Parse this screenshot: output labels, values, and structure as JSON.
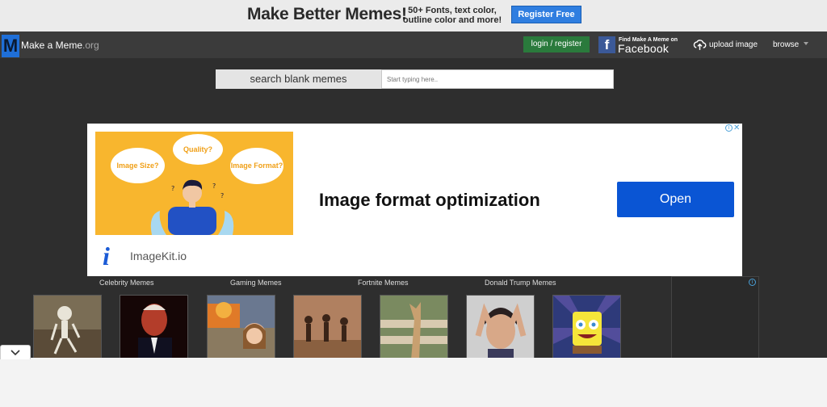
{
  "promo": {
    "title": "Make Better Memes!",
    "subtitle_line1": "50+ Fonts, text color,",
    "subtitle_line2": "outline color and more!",
    "register_label": "Register Free"
  },
  "nav": {
    "logo_letter": "M",
    "logo_name": "Make a Meme",
    "logo_tld": ".org",
    "login_label": "login / register",
    "facebook_small": "Find Make A Meme on",
    "facebook_big": "Facebook",
    "upload_label": "upload image",
    "browse_label": "browse"
  },
  "search": {
    "label": "search blank memes",
    "placeholder": "Start typing here.."
  },
  "ad": {
    "bubbles": [
      "Image Size?",
      "Quality?",
      "Image Format?"
    ],
    "headline": "Image format optimization",
    "cta": "Open",
    "brand": "ImageKit.io",
    "logo_glyph": "i",
    "info_glyph": "i",
    "close_glyph": "✕"
  },
  "categories": [
    "Celebrity Memes",
    "Gaming Memes",
    "Fortnite Memes",
    "Donald Trump Memes"
  ],
  "thumbnails": [
    "waiting-skeleton",
    "joe-biden",
    "disaster-girl",
    "dancing-kids",
    "whyyy-cat",
    "jackie-chan",
    "imagination-spongebob"
  ],
  "colors": {
    "register_blue": "#2f7ee0",
    "login_green": "#2a7a3c",
    "ad_open_blue": "#0a55d4",
    "page_bg": "#2e2e2e"
  }
}
